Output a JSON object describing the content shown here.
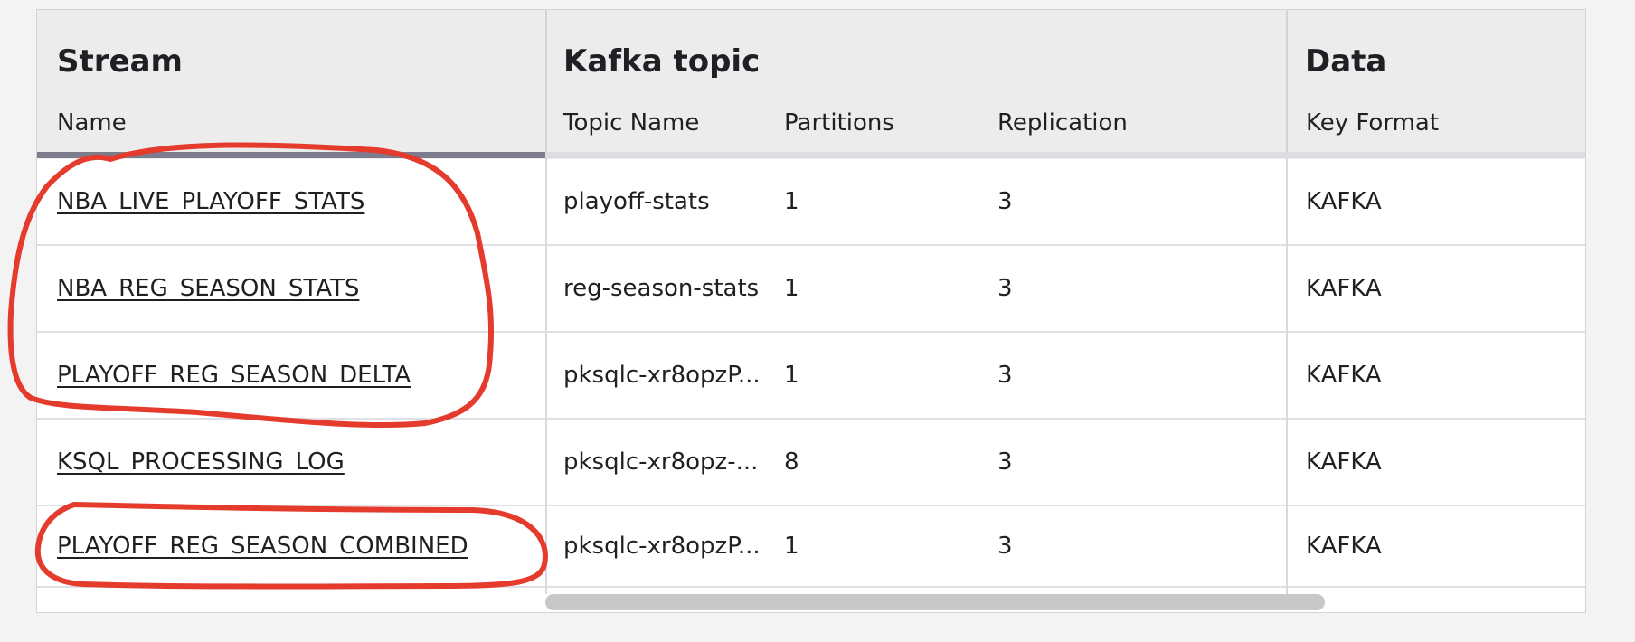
{
  "table": {
    "groups": [
      {
        "title": "Stream"
      },
      {
        "title": "Kafka topic"
      },
      {
        "title": "Data"
      }
    ],
    "columns": [
      {
        "label": "Name"
      },
      {
        "label": "Topic Name"
      },
      {
        "label": "Partitions"
      },
      {
        "label": "Replication"
      },
      {
        "label": "Key Format"
      }
    ],
    "rows": [
      {
        "name": "NBA_LIVE_PLAYOFF_STATS",
        "topic": "playoff-stats",
        "partitions": "1",
        "replication": "3",
        "key_format": "KAFKA"
      },
      {
        "name": "NBA_REG_SEASON_STATS",
        "topic": "reg-season-stats",
        "partitions": "1",
        "replication": "3",
        "key_format": "KAFKA"
      },
      {
        "name": "PLAYOFF_REG_SEASON_DELTA",
        "topic": "pksqlc-xr8opzP...",
        "partitions": "1",
        "replication": "3",
        "key_format": "KAFKA"
      },
      {
        "name": "KSQL_PROCESSING_LOG",
        "topic": "pksqlc-xr8opz-...",
        "partitions": "8",
        "replication": "3",
        "key_format": "KAFKA"
      },
      {
        "name": "PLAYOFF_REG_SEASON_COMBINED",
        "topic": "pksqlc-xr8opzP...",
        "partitions": "1",
        "replication": "3",
        "key_format": "KAFKA"
      }
    ]
  },
  "colors": {
    "annotation": "#e53b2d",
    "active_underline": "#7c7c8d"
  }
}
